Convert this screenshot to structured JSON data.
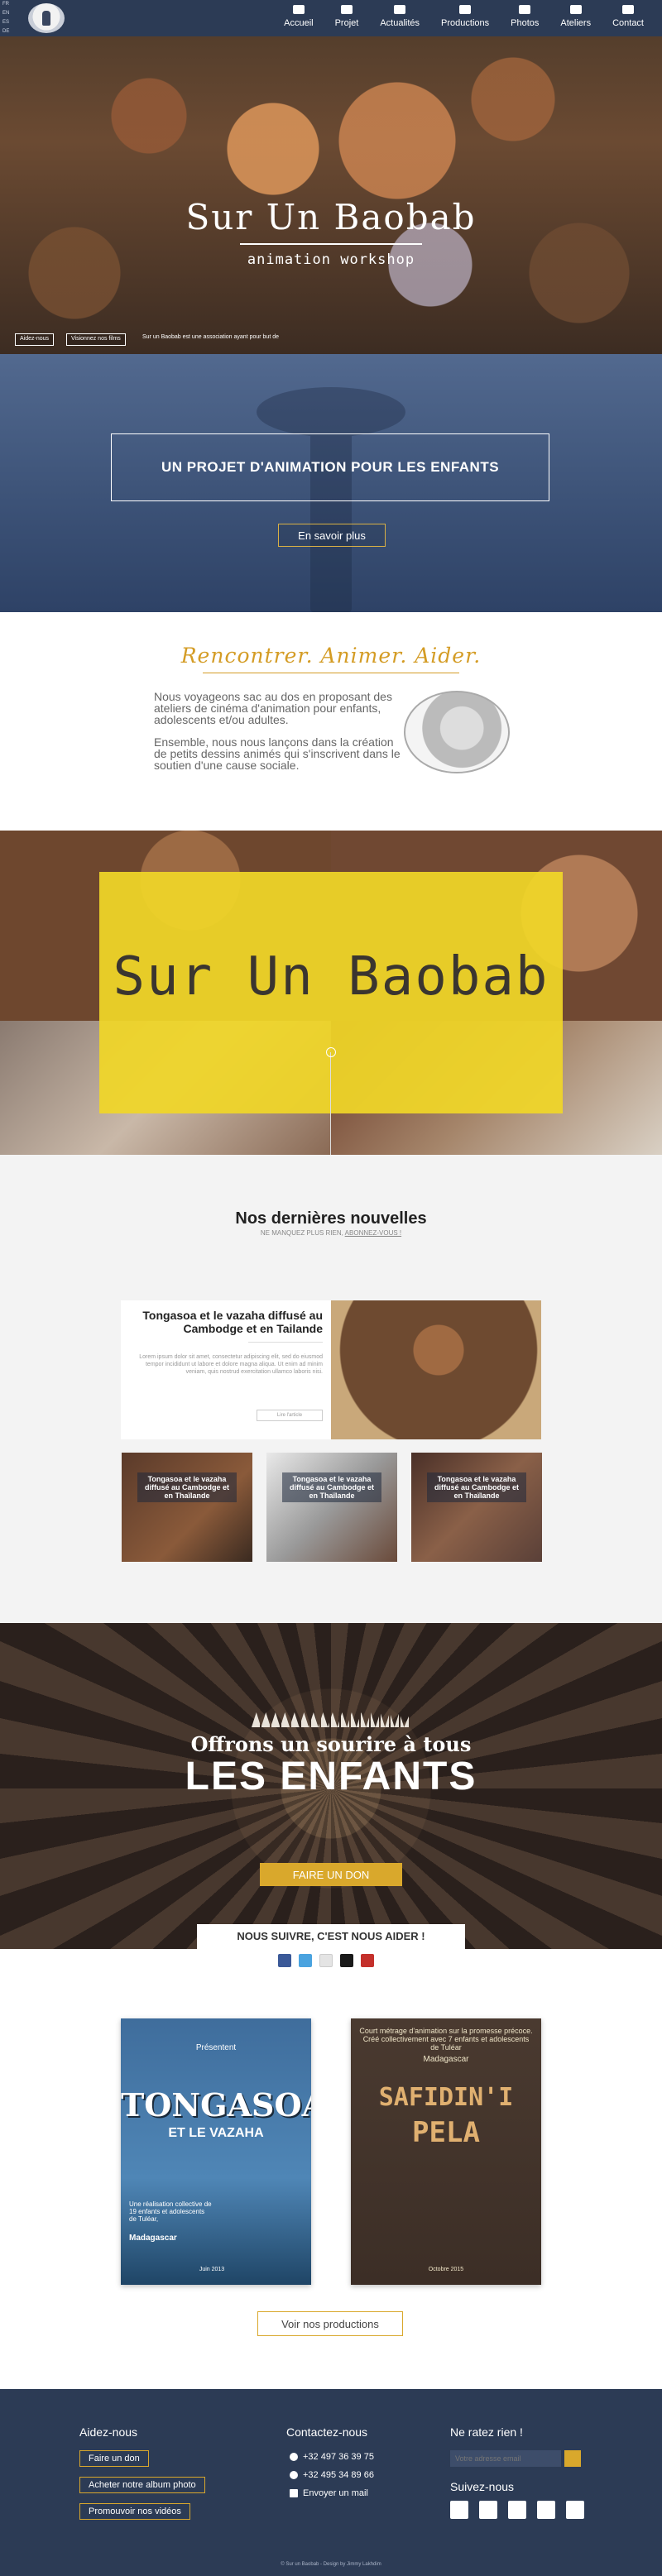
{
  "nav": {
    "langs": [
      "FR",
      "EN",
      "ES",
      "DE"
    ],
    "items": [
      {
        "label": "Accueil",
        "icon": "home-icon"
      },
      {
        "label": "Projet",
        "icon": "users-icon"
      },
      {
        "label": "Actualités",
        "icon": "chat-icon"
      },
      {
        "label": "Productions",
        "icon": "play-icon"
      },
      {
        "label": "Photos",
        "icon": "image-icon"
      },
      {
        "label": "Ateliers",
        "icon": "palette-icon"
      },
      {
        "label": "Contact",
        "icon": "mail-icon"
      }
    ]
  },
  "hero": {
    "title": "Sur Un Baobab",
    "subtitle": "animation workshop",
    "btn_help": "Aidez-nous",
    "btn_films": "Visionnez nos films",
    "note": "Sur un Baobab est une association ayant pour but de"
  },
  "intro": {
    "heading": "UN PROJET D'ANIMATION POUR LES ENFANTS",
    "cta": "En savoir plus"
  },
  "about": {
    "title": "Rencontrer. Animer. Aider.",
    "p1": "Nous voyageons sac au dos en proposant des ateliers de cinéma d'animation pour enfants, adolescents et/ou adultes.",
    "p2": "Ensemble, nous nous lançons dans la création de petits dessins animés qui s'inscrivent dans le soutien d'une cause sociale."
  },
  "collage": {
    "title": "Sur Un Baobab"
  },
  "news": {
    "title": "Nos dernières nouvelles",
    "sub_prefix": "NE MANQUEZ PLUS RIEN,",
    "sub_link": "ABONNEZ-VOUS !",
    "featured": {
      "title": "Tongasoa et le vazaha diffusé au Cambodge et en Tailande",
      "text": "Lorem ipsum dolor sit amet, consectetur adipiscing elit, sed do eiusmod tempor incididunt ut labore et dolore magna aliqua. Ut enim ad minim veniam, quis nostrud exercitation ullamco laboris nisi.",
      "btn": "Lire l'article"
    },
    "small": [
      "Tongasoa et le vazaha diffusé au Cambodge et en Thaïlande",
      "Tongasoa et le vazaha diffusé au Cambodge et en Thaïlande",
      "Tongasoa et le vazaha diffusé au Cambodge et en Thaïlande"
    ]
  },
  "donate": {
    "line1": "Offrons un sourire à tous",
    "line2": "LES ENFANTS",
    "btn": "FAIRE UN DON",
    "follow": "NOUS SUIVRE, C'EST NOUS AIDER !",
    "social": [
      {
        "icon": "facebook-icon",
        "color": "#3b5998"
      },
      {
        "icon": "twitter-icon",
        "color": "#4aa3df"
      },
      {
        "icon": "instagram-icon",
        "color": "#e4e4e4"
      },
      {
        "icon": "vimeo-icon",
        "color": "#1a1a1a"
      },
      {
        "icon": "youtube-icon",
        "color": "#c4302b"
      }
    ]
  },
  "productions": {
    "poster1": {
      "top": "Présentent",
      "title": "TONGASOA",
      "sub": "ET LE VAZAHA",
      "desc": "Une réalisation collective de 19 enfants et adolescents de Tuléar,",
      "place": "Madagascar",
      "date": "Juin 2013"
    },
    "poster2": {
      "top": "Court métrage d'animation sur la promesse précoce. Créé collectivement avec 7 enfants et adolescents de Tuléar",
      "place": "Madagascar",
      "title1": "SAFIDIN'I",
      "title2": "PELA",
      "date": "Octobre 2015"
    },
    "cta": "Voir nos productions"
  },
  "footer": {
    "help_title": "Aidez-nous",
    "help_buttons": [
      "Faire un don",
      "Acheter notre album photo",
      "Promouvoir nos vidéos"
    ],
    "contact_title": "Contactez-nous",
    "phone1": "+32 497 36 39 75",
    "phone2": "+32 495 34 89 66",
    "email": "Envoyer un mail",
    "newsletter_title": "Ne ratez rien !",
    "newsletter_placeholder": "Votre adresse email",
    "follow_title": "Suivez-nous",
    "social": [
      "facebook-icon",
      "twitter-icon",
      "instagram-icon",
      "vimeo-icon",
      "youtube-icon"
    ],
    "copyright": "© Sur un Baobab - Design by Jimmy Lakhdim"
  },
  "colors": {
    "navy": "#2c3b55",
    "gold": "#d9a82c",
    "yellow": "#f0d628"
  }
}
